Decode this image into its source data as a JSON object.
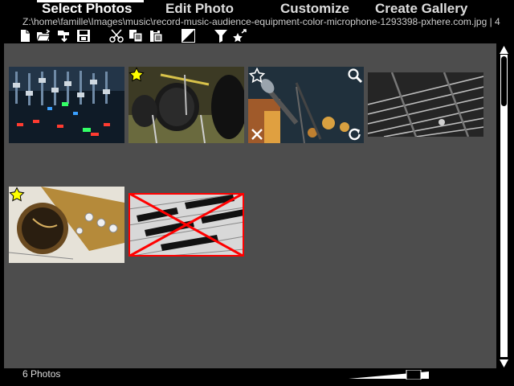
{
  "tabs": [
    {
      "label": "Select Photos",
      "active": true
    },
    {
      "label": "Edit Photo",
      "active": false
    },
    {
      "label": "Customize",
      "active": false
    },
    {
      "label": "Create Gallery",
      "active": false
    }
  ],
  "path": "Z:\\home\\famille\\Images\\music\\record-music-audience-equipment-color-microphone-1293398-pxhere.com.jpg | 4",
  "toolbar": {
    "icons": [
      "new-file-icon",
      "open-folder-icon",
      "import-icon",
      "save-icon",
      "cut-icon",
      "copy-icon",
      "paste-icon",
      "contrast-icon",
      "filter-icon",
      "star-sparkle-icon"
    ]
  },
  "photos": [
    {
      "name": "mixing-console",
      "starred": false,
      "selected": false,
      "deleted": false,
      "color": "#1d2a38"
    },
    {
      "name": "drum-kit",
      "starred": true,
      "selected": false,
      "deleted": false,
      "color": "#4a4a2c"
    },
    {
      "name": "microphone",
      "starred": false,
      "selected": true,
      "deleted": false,
      "color": "#2d3d4a"
    },
    {
      "name": "guitar-strings",
      "starred": false,
      "selected": false,
      "deleted": false,
      "color": "#262626"
    },
    {
      "name": "saxophone",
      "starred": true,
      "selected": false,
      "deleted": false,
      "color": "#8a6a3a"
    },
    {
      "name": "piano-keys",
      "starred": false,
      "selected": false,
      "deleted": true,
      "color": "#c8c8c8"
    }
  ],
  "status": {
    "count": "6 Photos",
    "zoom": 0.55
  },
  "colors": {
    "grid_bg": "#4d4d4d",
    "star": "#ffff00",
    "delete_mark": "#ff0000"
  }
}
